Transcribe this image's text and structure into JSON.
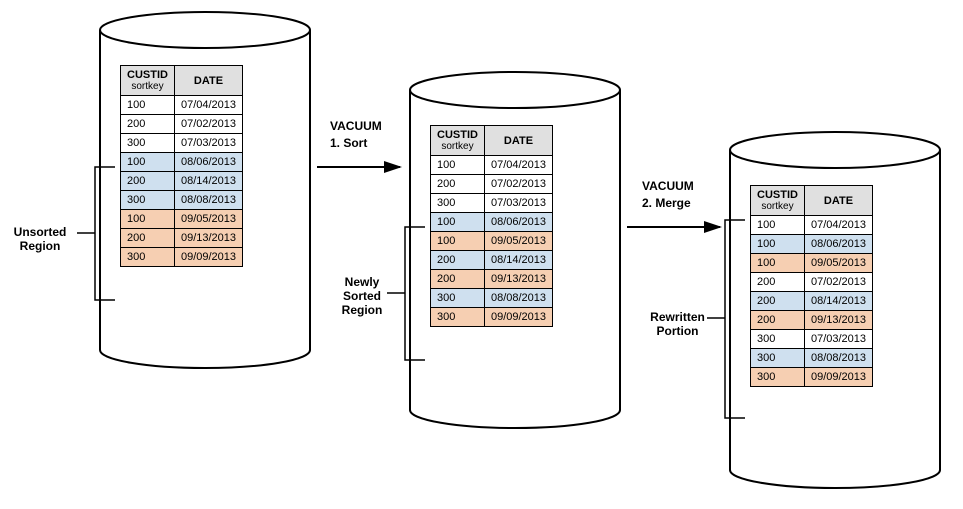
{
  "headers": {
    "custid": "CUSTID",
    "sortkey": "sortkey",
    "date": "DATE"
  },
  "labels": {
    "unsorted": "Unsorted\nRegion",
    "newlysorted": "Newly\nSorted\nRegion",
    "rewritten": "Rewritten\nPortion",
    "vacuum": "VACUUM",
    "step1": "1. Sort",
    "step2": "2. Merge"
  },
  "table1": [
    {
      "c": "100",
      "d": "07/04/2013",
      "k": "white"
    },
    {
      "c": "200",
      "d": "07/02/2013",
      "k": "white"
    },
    {
      "c": "300",
      "d": "07/03/2013",
      "k": "white"
    },
    {
      "c": "100",
      "d": "08/06/2013",
      "k": "blue"
    },
    {
      "c": "200",
      "d": "08/14/2013",
      "k": "blue"
    },
    {
      "c": "300",
      "d": "08/08/2013",
      "k": "blue"
    },
    {
      "c": "100",
      "d": "09/05/2013",
      "k": "orange"
    },
    {
      "c": "200",
      "d": "09/13/2013",
      "k": "orange"
    },
    {
      "c": "300",
      "d": "09/09/2013",
      "k": "orange"
    }
  ],
  "table2": [
    {
      "c": "100",
      "d": "07/04/2013",
      "k": "white"
    },
    {
      "c": "200",
      "d": "07/02/2013",
      "k": "white"
    },
    {
      "c": "300",
      "d": "07/03/2013",
      "k": "white"
    },
    {
      "c": "100",
      "d": "08/06/2013",
      "k": "blue"
    },
    {
      "c": "100",
      "d": "09/05/2013",
      "k": "orange"
    },
    {
      "c": "200",
      "d": "08/14/2013",
      "k": "blue"
    },
    {
      "c": "200",
      "d": "09/13/2013",
      "k": "orange"
    },
    {
      "c": "300",
      "d": "08/08/2013",
      "k": "blue"
    },
    {
      "c": "300",
      "d": "09/09/2013",
      "k": "orange"
    }
  ],
  "table3": [
    {
      "c": "100",
      "d": "07/04/2013",
      "k": "white"
    },
    {
      "c": "100",
      "d": "08/06/2013",
      "k": "blue"
    },
    {
      "c": "100",
      "d": "09/05/2013",
      "k": "orange"
    },
    {
      "c": "200",
      "d": "07/02/2013",
      "k": "white"
    },
    {
      "c": "200",
      "d": "08/14/2013",
      "k": "blue"
    },
    {
      "c": "200",
      "d": "09/13/2013",
      "k": "orange"
    },
    {
      "c": "300",
      "d": "07/03/2013",
      "k": "white"
    },
    {
      "c": "300",
      "d": "08/08/2013",
      "k": "blue"
    },
    {
      "c": "300",
      "d": "09/09/2013",
      "k": "orange"
    }
  ]
}
